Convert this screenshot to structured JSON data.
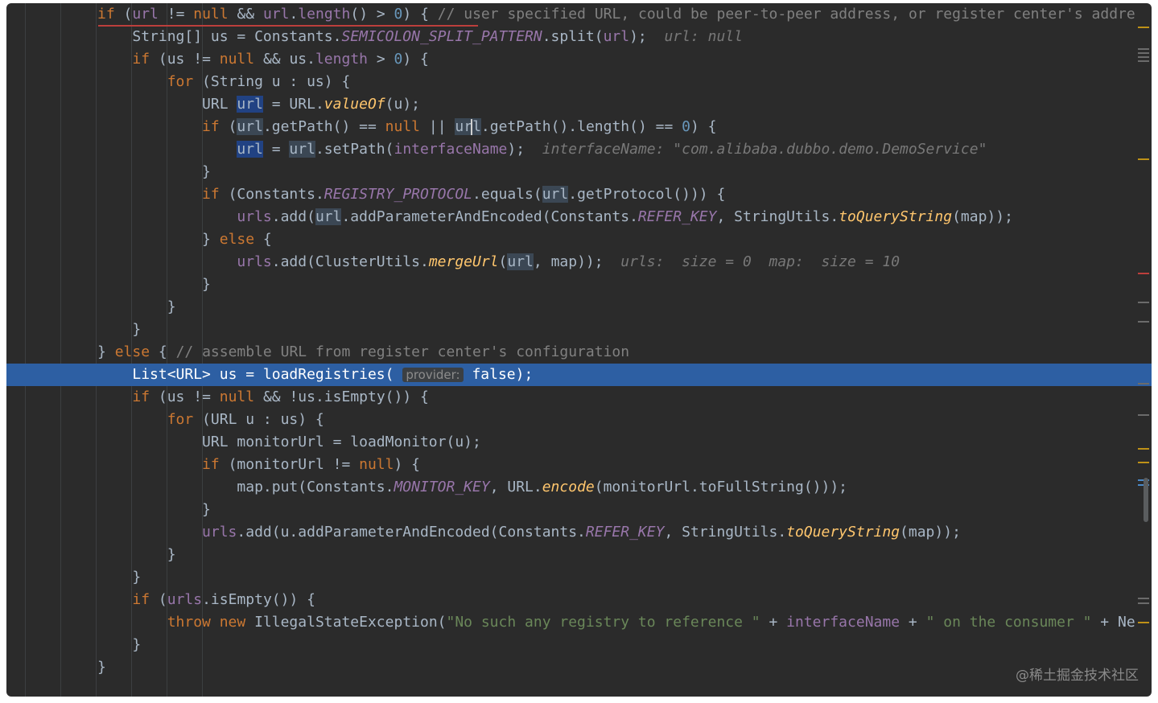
{
  "watermark": "@稀土掘金技术社区",
  "code": {
    "l0_a": "if",
    "l0_b": " (",
    "l0_c": "url",
    "l0_d": " != ",
    "l0_e": "null",
    "l0_f": " && ",
    "l0_g": "url",
    "l0_h": ".",
    "l0_i": "length",
    "l0_j": "() > ",
    "l0_k": "0",
    "l0_l": ") { ",
    "l0_m": "// user specified URL, could be peer-to-peer address, or register center's addre",
    "l1_a": "String[] us = Constants.",
    "l1_b": "SEMICOLON_SPLIT_PATTERN",
    "l1_c": ".split(",
    "l1_d": "url",
    "l1_e": ");  ",
    "l1_f": "url: null",
    "l2_a": "if",
    "l2_b": " (us != ",
    "l2_c": "null",
    "l2_d": " && us.",
    "l2_e": "length",
    "l2_f": " > ",
    "l2_g": "0",
    "l2_h": ") {",
    "l3_a": "for",
    "l3_b": " (String u : us) {",
    "l4_a": "URL ",
    "l4_b": "url",
    "l4_c": " = URL.",
    "l4_d": "valueOf",
    "l4_e": "(u);",
    "l5_a": "if",
    "l5_b": " (",
    "l5_c": "url",
    "l5_d": ".getPath() == ",
    "l5_e": "null",
    "l5_f": " || ",
    "l5_g1": "ur",
    "l5_g2": "l",
    "l5_h": ".getPath().length() == ",
    "l5_i": "0",
    "l5_j": ") {",
    "l6_a": "url",
    "l6_b": " = ",
    "l6_c": "url",
    "l6_d": ".setPath(",
    "l6_e": "interfaceName",
    "l6_f": ");  ",
    "l6_g": "interfaceName: \"com.alibaba.dubbo.demo.DemoService\"",
    "l7_a": "}",
    "l8_a": "if",
    "l8_b": " (Constants.",
    "l8_c": "REGISTRY_PROTOCOL",
    "l8_d": ".equals(",
    "l8_e": "url",
    "l8_f": ".getProtocol())) {",
    "l9_a": "urls",
    "l9_b": ".add(",
    "l9_c": "url",
    "l9_d": ".addParameterAndEncoded(Constants.",
    "l9_e": "REFER_KEY",
    "l9_f": ", StringUtils.",
    "l9_g": "toQueryString",
    "l9_h": "(map));",
    "l10_a": "} ",
    "l10_b": "else",
    "l10_c": " {",
    "l11_a": "urls",
    "l11_b": ".add(ClusterUtils.",
    "l11_c": "mergeUrl",
    "l11_d": "(",
    "l11_e": "url",
    "l11_f": ", map));  ",
    "l11_g": "urls:  size = 0  map:  size = 10",
    "l12_a": "}",
    "l13_a": "}",
    "l14_a": "}",
    "l15_a": "} ",
    "l15_b": "else",
    "l15_c": " { ",
    "l15_d": "// assemble URL from register center's configuration",
    "l16_a": "List<URL> us = loadRegistries( ",
    "l16_b": "provider:",
    "l16_c": " false",
    "l16_d": ");",
    "l17_a": "if",
    "l17_b": " (us != ",
    "l17_c": "null",
    "l17_d": " && !us.isEmpty()) {",
    "l18_a": "for",
    "l18_b": " (URL u : us) {",
    "l19_a": "URL monitorUrl = loadMonitor(u);",
    "l20_a": "if",
    "l20_b": " (monitorUrl != ",
    "l20_c": "null",
    "l20_d": ") {",
    "l21_a": "map.put(Constants.",
    "l21_b": "MONITOR_KEY",
    "l21_c": ", URL.",
    "l21_d": "encode",
    "l21_e": "(monitorUrl.toFullString()));",
    "l22_a": "}",
    "l23_a": "urls",
    "l23_b": ".add(u.addParameterAndEncoded(Constants.",
    "l23_c": "REFER_KEY",
    "l23_d": ", StringUtils.",
    "l23_e": "toQueryString",
    "l23_f": "(map));",
    "l24_a": "}",
    "l25_a": "}",
    "l26_a": "if",
    "l26_b": " (",
    "l26_c": "urls",
    "l26_d": ".isEmpty()) {",
    "l27_a": "throw new",
    "l27_b": " IllegalStateException(",
    "l27_c": "\"No such any registry to reference \"",
    "l27_d": " + ",
    "l27_e": "interfaceName",
    "l27_f": " + ",
    "l27_g": "\" on the consumer \"",
    "l27_h": " + Ne",
    "l28_a": "}",
    "l29_a": "}"
  },
  "colors": {
    "background": "#2b2b2b",
    "execution_line": "#2d5fa3",
    "keyword": "#cc7832",
    "field": "#9876aa",
    "string": "#6a8759",
    "number": "#6897bb",
    "comment": "#808080",
    "error_mark": "#bc3f3c",
    "warning_mark": "#be9117"
  }
}
